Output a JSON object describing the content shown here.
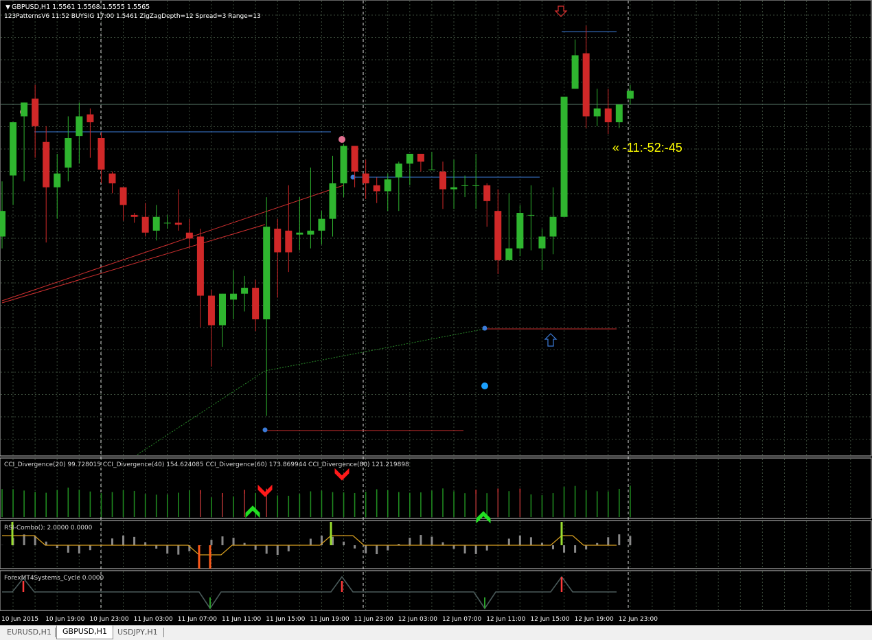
{
  "header": {
    "symbol_line": "GBPUSD,H1  1.5561 1.5568 1.5555 1.5565",
    "indicator_line": "123PatternsV6  11:52  BUYSIG  17:00  1.5461  ZigZagDepth=12  Spread=3  Range=13"
  },
  "countdown": "« -11:-52:-45",
  "panels": {
    "cci_label": "CCI_Divergence(20) 99.728015  CCI_Divergence(40) 154.624085  CCI_Divergence(60) 173.869944  CCI_Divergence(80) 121.219898",
    "rsi_label": "RSI-Combo(): 2.0000 0.0000",
    "cycle_label": "ForexMT4Systems_Cycle 0.0000"
  },
  "time_axis": [
    "10 Jun 2015",
    "10 Jun 19:00",
    "10 Jun 23:00",
    "11 Jun 03:00",
    "11 Jun 07:00",
    "11 Jun 11:00",
    "11 Jun 15:00",
    "11 Jun 19:00",
    "11 Jun 23:00",
    "12 Jun 03:00",
    "12 Jun 07:00",
    "12 Jun 11:00",
    "12 Jun 15:00",
    "12 Jun 19:00",
    "12 Jun 23:00"
  ],
  "tabs": [
    {
      "label": "EURUSD,H1",
      "active": false
    },
    {
      "label": "GBPUSD,H1",
      "active": true
    },
    {
      "label": "USDJPY,H1",
      "active": false
    }
  ],
  "colors": {
    "background": "#000000",
    "grid": "#3a4a3a",
    "bull": "#2fb52f",
    "bear": "#d02828",
    "text": "#d8d8d8",
    "countdown": "#ffff00",
    "level_blue": "#3b7bd8",
    "level_red": "#d03030"
  },
  "chart_data": {
    "type": "candlestick",
    "symbol": "GBPUSD",
    "timeframe": "H1",
    "candles": [
      {
        "o": 1.5466,
        "h": 1.5494,
        "l": 1.546,
        "c": 1.5479
      },
      {
        "o": 1.5497,
        "h": 1.5516,
        "l": 1.5482,
        "c": 1.5524
      },
      {
        "o": 1.5527,
        "h": 1.5534,
        "l": 1.5494,
        "c": 1.5534
      },
      {
        "o": 1.5536,
        "h": 1.5543,
        "l": 1.5506,
        "c": 1.5522
      },
      {
        "o": 1.5514,
        "h": 1.5522,
        "l": 1.5463,
        "c": 1.5491
      },
      {
        "o": 1.5491,
        "h": 1.5508,
        "l": 1.5475,
        "c": 1.5498
      },
      {
        "o": 1.5501,
        "h": 1.5527,
        "l": 1.5494,
        "c": 1.5516
      },
      {
        "o": 1.5517,
        "h": 1.5534,
        "l": 1.5503,
        "c": 1.5527
      },
      {
        "o": 1.5528,
        "h": 1.5531,
        "l": 1.5506,
        "c": 1.5524
      },
      {
        "o": 1.5516,
        "h": 1.5519,
        "l": 1.5493,
        "c": 1.55
      },
      {
        "o": 1.5498,
        "h": 1.5499,
        "l": 1.5488,
        "c": 1.5493
      },
      {
        "o": 1.5491,
        "h": 1.5491,
        "l": 1.5474,
        "c": 1.5482
      },
      {
        "o": 1.5477,
        "h": 1.5478,
        "l": 1.5473,
        "c": 1.5476
      },
      {
        "o": 1.5476,
        "h": 1.5483,
        "l": 1.5466,
        "c": 1.5468
      },
      {
        "o": 1.5469,
        "h": 1.5482,
        "l": 1.5464,
        "c": 1.5476
      },
      {
        "o": 1.5473,
        "h": 1.5477,
        "l": 1.547,
        "c": 1.5473
      },
      {
        "o": 1.5473,
        "h": 1.549,
        "l": 1.5469,
        "c": 1.5472
      },
      {
        "o": 1.5468,
        "h": 1.5475,
        "l": 1.546,
        "c": 1.5465
      },
      {
        "o": 1.5466,
        "h": 1.547,
        "l": 1.542,
        "c": 1.5436
      },
      {
        "o": 1.5436,
        "h": 1.5439,
        "l": 1.54,
        "c": 1.5421
      },
      {
        "o": 1.5421,
        "h": 1.5437,
        "l": 1.541,
        "c": 1.5437
      },
      {
        "o": 1.5434,
        "h": 1.5449,
        "l": 1.5424,
        "c": 1.5437
      },
      {
        "o": 1.5437,
        "h": 1.5446,
        "l": 1.5428,
        "c": 1.544
      },
      {
        "o": 1.544,
        "h": 1.5444,
        "l": 1.5418,
        "c": 1.5424
      },
      {
        "o": 1.5424,
        "h": 1.5486,
        "l": 1.5375,
        "c": 1.5471
      },
      {
        "o": 1.547,
        "h": 1.5475,
        "l": 1.5435,
        "c": 1.5458
      },
      {
        "o": 1.5469,
        "h": 1.5492,
        "l": 1.5448,
        "c": 1.5458
      },
      {
        "o": 1.5467,
        "h": 1.5486,
        "l": 1.5459,
        "c": 1.5468
      },
      {
        "o": 1.5467,
        "h": 1.5501,
        "l": 1.546,
        "c": 1.5469
      },
      {
        "o": 1.5469,
        "h": 1.5479,
        "l": 1.5462,
        "c": 1.5475
      },
      {
        "o": 1.5475,
        "h": 1.5507,
        "l": 1.5466,
        "c": 1.5493
      },
      {
        "o": 1.5493,
        "h": 1.5513,
        "l": 1.5486,
        "c": 1.5512
      },
      {
        "o": 1.5512,
        "h": 1.5512,
        "l": 1.5491,
        "c": 1.5499
      },
      {
        "o": 1.5498,
        "h": 1.5505,
        "l": 1.5485,
        "c": 1.5493
      },
      {
        "o": 1.5492,
        "h": 1.5496,
        "l": 1.5483,
        "c": 1.5489
      },
      {
        "o": 1.5489,
        "h": 1.5498,
        "l": 1.5479,
        "c": 1.5495
      },
      {
        "o": 1.5496,
        "h": 1.5504,
        "l": 1.5479,
        "c": 1.5503
      },
      {
        "o": 1.5503,
        "h": 1.5505,
        "l": 1.5492,
        "c": 1.5508
      },
      {
        "o": 1.5508,
        "h": 1.5508,
        "l": 1.5499,
        "c": 1.5504
      },
      {
        "o": 1.55,
        "h": 1.5509,
        "l": 1.55,
        "c": 1.55
      },
      {
        "o": 1.5499,
        "h": 1.5504,
        "l": 1.548,
        "c": 1.549
      },
      {
        "o": 1.549,
        "h": 1.5505,
        "l": 1.548,
        "c": 1.5491
      },
      {
        "o": 1.5492,
        "h": 1.5497,
        "l": 1.5486,
        "c": 1.5492
      },
      {
        "o": 1.5492,
        "h": 1.5508,
        "l": 1.548,
        "c": 1.5492
      },
      {
        "o": 1.5492,
        "h": 1.5493,
        "l": 1.5471,
        "c": 1.5484
      },
      {
        "o": 1.5479,
        "h": 1.549,
        "l": 1.5447,
        "c": 1.5454
      },
      {
        "o": 1.5454,
        "h": 1.5488,
        "l": 1.5454,
        "c": 1.546
      },
      {
        "o": 1.546,
        "h": 1.5482,
        "l": 1.5456,
        "c": 1.5478
      },
      {
        "o": 1.5477,
        "h": 1.5492,
        "l": 1.5459,
        "c": 1.5477
      },
      {
        "o": 1.546,
        "h": 1.547,
        "l": 1.5449,
        "c": 1.5466
      },
      {
        "o": 1.5466,
        "h": 1.5491,
        "l": 1.5457,
        "c": 1.5476
      },
      {
        "o": 1.5476,
        "h": 1.5515,
        "l": 1.5476,
        "c": 1.5537
      },
      {
        "o": 1.5541,
        "h": 1.5566,
        "l": 1.5541,
        "c": 1.5558
      },
      {
        "o": 1.5559,
        "h": 1.5573,
        "l": 1.5521,
        "c": 1.5527
      },
      {
        "o": 1.5527,
        "h": 1.5541,
        "l": 1.5522,
        "c": 1.5531
      },
      {
        "o": 1.5531,
        "h": 1.5541,
        "l": 1.5518,
        "c": 1.5524
      },
      {
        "o": 1.5524,
        "h": 1.5532,
        "l": 1.5521,
        "c": 1.5533
      },
      {
        "o": 1.5536,
        "h": 1.5543,
        "l": 1.5533,
        "c": 1.554
      }
    ],
    "y_range": [
      1.5355,
      1.5585
    ],
    "grid": true
  }
}
